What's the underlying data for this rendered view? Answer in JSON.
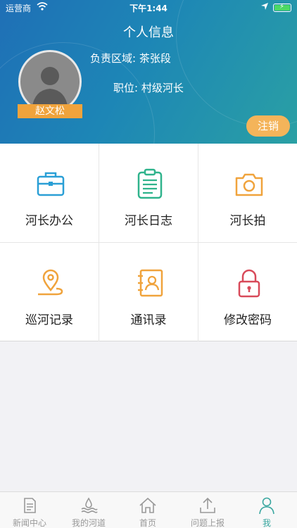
{
  "status_bar": {
    "carrier": "运营商",
    "time": "下午1:44"
  },
  "header": {
    "title": "个人信息",
    "user_name": "赵文松",
    "area": "负责区域: 茶张段",
    "position": "职位: 村级河长",
    "logout_label": "注销"
  },
  "menu": {
    "items": [
      {
        "label": "河长办公",
        "icon": "briefcase-icon",
        "color": "#2a9fd6"
      },
      {
        "label": "河长日志",
        "icon": "clipboard-icon",
        "color": "#2fb38c"
      },
      {
        "label": "河长拍",
        "icon": "camera-icon",
        "color": "#f0a33c"
      },
      {
        "label": "巡河记录",
        "icon": "location-pin-icon",
        "color": "#f0a33c"
      },
      {
        "label": "通讯录",
        "icon": "contacts-icon",
        "color": "#f0a33c"
      },
      {
        "label": "修改密码",
        "icon": "lock-icon",
        "color": "#d84a5a"
      }
    ]
  },
  "tabbar": {
    "items": [
      {
        "label": "新闻中心",
        "icon": "news-icon"
      },
      {
        "label": "我的河道",
        "icon": "river-icon"
      },
      {
        "label": "首页",
        "icon": "home-icon"
      },
      {
        "label": "问题上报",
        "icon": "upload-icon"
      },
      {
        "label": "我",
        "icon": "person-icon"
      }
    ],
    "active_color": "#3aa7a0",
    "inactive_color": "#999999"
  },
  "colors": {
    "header_start": "#1f6fb6",
    "header_end": "#2aa0a4",
    "badge": "#f0a33c",
    "logout": "#f4b45a"
  }
}
